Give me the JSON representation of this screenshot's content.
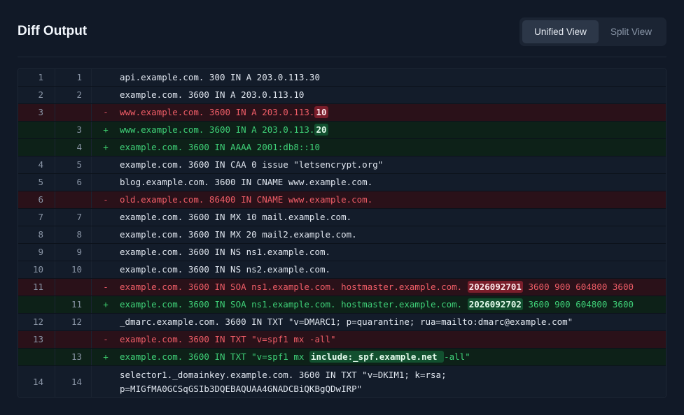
{
  "header": {
    "title": "Diff Output",
    "view_toggle": {
      "unified_label": "Unified View",
      "split_label": "Split View",
      "selected": "Unified View"
    }
  },
  "diff": {
    "rows": [
      {
        "type": "ctx",
        "old": "1",
        "new": "1",
        "sign": "",
        "text": "api.example.com. 300 IN A 203.0.113.30"
      },
      {
        "type": "ctx",
        "old": "2",
        "new": "2",
        "sign": "",
        "text": "example.com. 3600 IN A 203.0.113.10"
      },
      {
        "type": "del",
        "old": "3",
        "new": "",
        "sign": "-",
        "text": "www.example.com. 3600 IN A 203.0.113.",
        "hl": "10",
        "after": ""
      },
      {
        "type": "add",
        "old": "",
        "new": "3",
        "sign": "+",
        "text": "www.example.com. 3600 IN A 203.0.113.",
        "hl": "20",
        "after": ""
      },
      {
        "type": "add",
        "old": "",
        "new": "4",
        "sign": "+",
        "text": "example.com. 3600 IN AAAA 2001:db8::10"
      },
      {
        "type": "ctx",
        "old": "4",
        "new": "5",
        "sign": "",
        "text": "example.com. 3600 IN CAA 0 issue \"letsencrypt.org\""
      },
      {
        "type": "ctx",
        "old": "5",
        "new": "6",
        "sign": "",
        "text": "blog.example.com. 3600 IN CNAME www.example.com."
      },
      {
        "type": "del",
        "old": "6",
        "new": "",
        "sign": "-",
        "text": "old.example.com. 86400 IN CNAME www.example.com."
      },
      {
        "type": "ctx",
        "old": "7",
        "new": "7",
        "sign": "",
        "text": "example.com. 3600 IN MX 10 mail.example.com."
      },
      {
        "type": "ctx",
        "old": "8",
        "new": "8",
        "sign": "",
        "text": "example.com. 3600 IN MX 20 mail2.example.com."
      },
      {
        "type": "ctx",
        "old": "9",
        "new": "9",
        "sign": "",
        "text": "example.com. 3600 IN NS ns1.example.com."
      },
      {
        "type": "ctx",
        "old": "10",
        "new": "10",
        "sign": "",
        "text": "example.com. 3600 IN NS ns2.example.com."
      },
      {
        "type": "del",
        "old": "11",
        "new": "",
        "sign": "-",
        "text": "example.com. 3600 IN SOA ns1.example.com. hostmaster.example.com. ",
        "hl": "2026092701",
        "after": " 3600 900 604800 3600"
      },
      {
        "type": "add",
        "old": "",
        "new": "11",
        "sign": "+",
        "text": "example.com. 3600 IN SOA ns1.example.com. hostmaster.example.com. ",
        "hl": "2026092702",
        "after": " 3600 900 604800 3600"
      },
      {
        "type": "ctx",
        "old": "12",
        "new": "12",
        "sign": "",
        "text": "_dmarc.example.com. 3600 IN TXT \"v=DMARC1; p=quarantine; rua=mailto:dmarc@example.com\""
      },
      {
        "type": "del",
        "old": "13",
        "new": "",
        "sign": "-",
        "text": "example.com. 3600 IN TXT \"v=spf1 mx -all\""
      },
      {
        "type": "add",
        "old": "",
        "new": "13",
        "sign": "+",
        "text": "example.com. 3600 IN TXT \"v=spf1 mx ",
        "hl": "include:_spf.example.net ",
        "after": "-all\""
      },
      {
        "type": "ctx",
        "old": "14",
        "new": "14",
        "sign": "",
        "text": "selector1._domainkey.example.com. 3600 IN TXT \"v=DKIM1; k=rsa; p=MIGfMA0GCSqGSIb3DQEBAQUAA4GNADCBiQKBgQDwIRP\"",
        "tall": true
      }
    ]
  }
}
